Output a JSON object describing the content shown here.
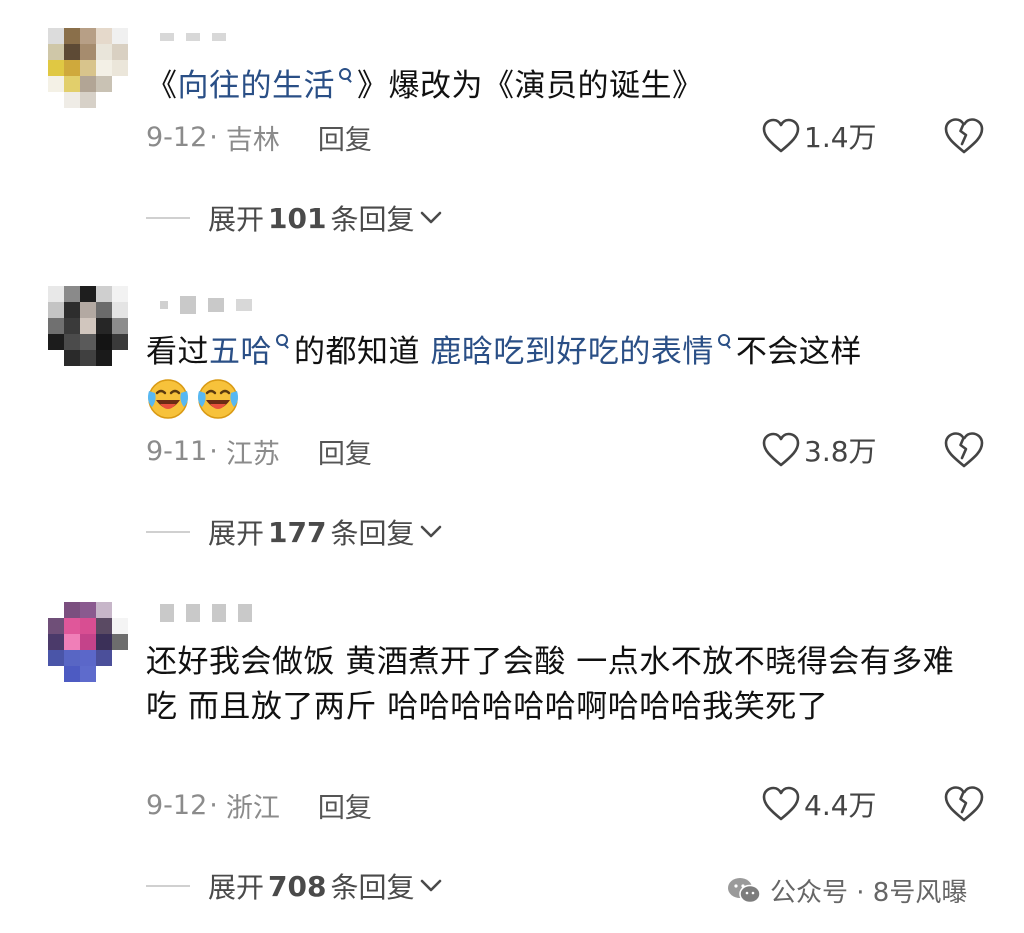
{
  "comments": [
    {
      "segments": [
        {
          "text": "《",
          "type": "plain"
        },
        {
          "text": "向往的生活",
          "type": "link"
        },
        {
          "text": "》爆改为《演员的诞生》",
          "type": "plain"
        }
      ],
      "date": "9-12",
      "location": "吉林",
      "reply_label": "回复",
      "likes": "1.4万",
      "expand": {
        "prefix": "展开",
        "count": "101",
        "suffix": "条回复"
      }
    },
    {
      "segments": [
        {
          "text": "看过",
          "type": "plain"
        },
        {
          "text": "五哈",
          "type": "link"
        },
        {
          "text": "的都知道 ",
          "type": "plain"
        },
        {
          "text": "鹿晗吃到好吃的表情",
          "type": "link"
        },
        {
          "text": "不会这样",
          "type": "plain"
        }
      ],
      "emoji_count": 2,
      "emoji_name": "laughing-crying-emoji",
      "date": "9-11",
      "location": "江苏",
      "reply_label": "回复",
      "likes": "3.8万",
      "expand": {
        "prefix": "展开",
        "count": "177",
        "suffix": "条回复"
      }
    },
    {
      "text": "还好我会做饭 黄酒煮开了会酸 一点水不放不晓得会有多难吃 而且放了两斤 哈哈哈哈哈哈啊哈哈哈我笑死了",
      "date": "9-12",
      "location": "浙江",
      "reply_label": "回复",
      "likes": "4.4万",
      "expand": {
        "prefix": "展开",
        "count": "708",
        "suffix": "条回复"
      }
    }
  ],
  "watermark": {
    "label": "公众号 · 8号风曝"
  },
  "icons": {
    "like": "heart-outline-icon",
    "dislike": "broken-heart-icon",
    "expand": "chevron-down-icon",
    "search_link": "search-icon",
    "watermark": "wechat-icon"
  },
  "colors": {
    "link": "#2a4f86",
    "meta": "#8b8b8b",
    "text": "#111111"
  }
}
